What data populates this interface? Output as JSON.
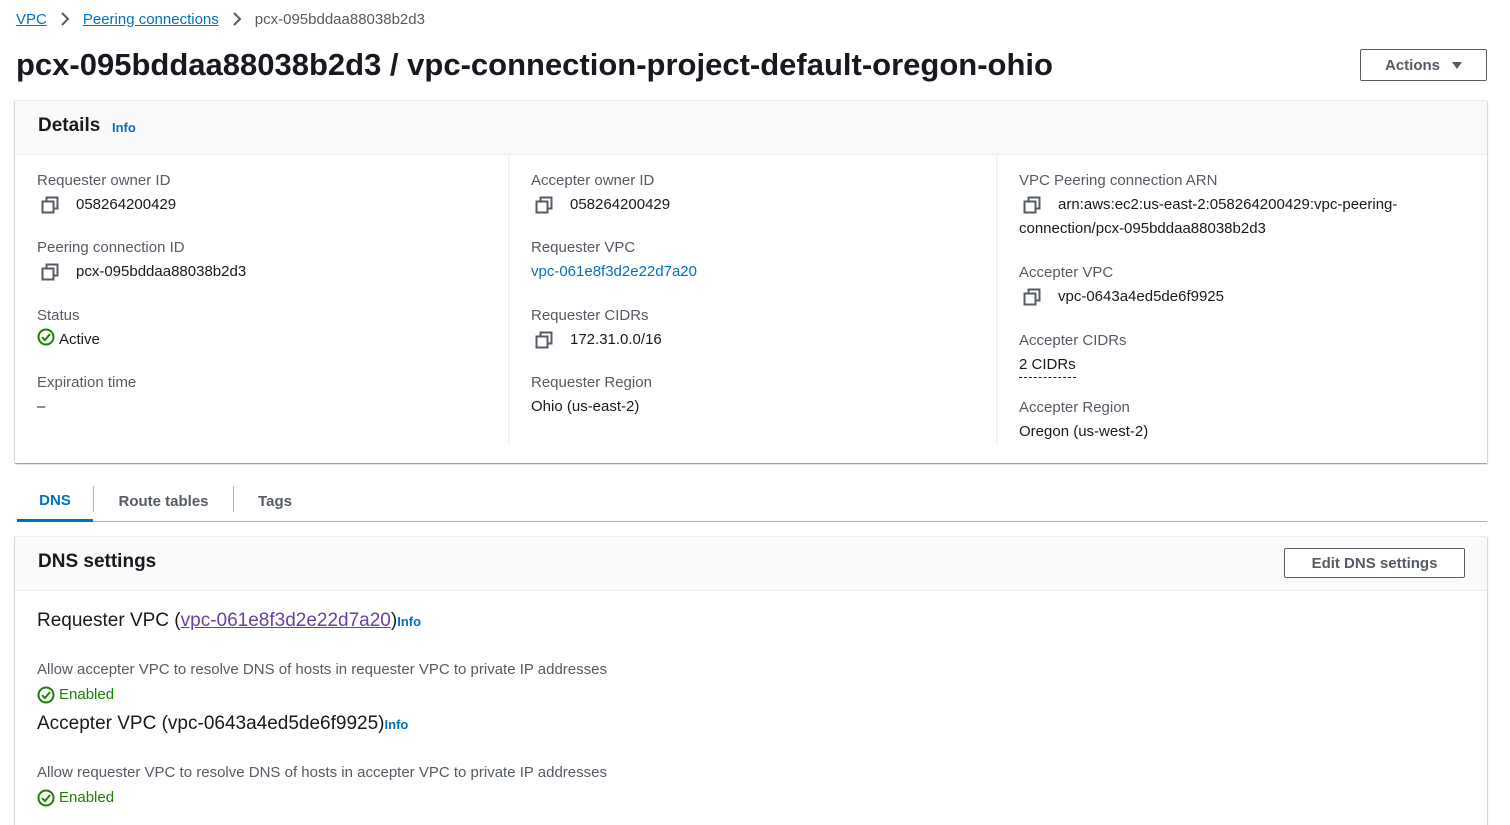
{
  "breadcrumb": {
    "items": [
      "VPC",
      "Peering connections"
    ],
    "current": "pcx-095bddaa88038b2d3"
  },
  "page": {
    "title": "pcx-095bddaa88038b2d3 / vpc-connection-project-default-oregon-ohio",
    "actions_label": "Actions"
  },
  "details": {
    "title": "Details",
    "info": "Info",
    "col1": {
      "requester_owner_id_label": "Requester owner ID",
      "requester_owner_id": "058264200429",
      "peering_id_label": "Peering connection ID",
      "peering_id": "pcx-095bddaa88038b2d3",
      "status_label": "Status",
      "status": "Active",
      "expiration_label": "Expiration time",
      "expiration": "–"
    },
    "col2": {
      "accepter_owner_id_label": "Accepter owner ID",
      "accepter_owner_id": "058264200429",
      "requester_vpc_label": "Requester VPC",
      "requester_vpc": "vpc-061e8f3d2e22d7a20",
      "requester_cidrs_label": "Requester CIDRs",
      "requester_cidrs": "172.31.0.0/16",
      "requester_region_label": "Requester Region",
      "requester_region": "Ohio (us-east-2)"
    },
    "col3": {
      "arn_label": "VPC Peering connection ARN",
      "arn_line1": "arn:aws:ec2:us-east-2:058264200429:vpc-peering-",
      "arn_line2": "connection/pcx-095bddaa88038b2d3",
      "accepter_vpc_label": "Accepter VPC",
      "accepter_vpc": "vpc-0643a4ed5de6f9925",
      "accepter_cidrs_label": "Accepter CIDRs",
      "accepter_cidrs": "2 CIDRs",
      "accepter_region_label": "Accepter Region",
      "accepter_region": "Oregon (us-west-2)"
    }
  },
  "tabs": [
    "DNS",
    "Route tables",
    "Tags"
  ],
  "dns": {
    "title": "DNS settings",
    "edit_label": "Edit DNS settings",
    "requester": {
      "prefix": "Requester VPC (",
      "vpc": "vpc-061e8f3d2e22d7a20",
      "suffix": ")",
      "info": "Info",
      "description": "Allow accepter VPC to resolve DNS of hosts in requester VPC to private IP addresses",
      "status": "Enabled"
    },
    "accepter": {
      "heading": "Accepter VPC (vpc-0643a4ed5de6f9925)",
      "info": "Info",
      "description": "Allow requester VPC to resolve DNS of hosts in accepter VPC to private IP addresses",
      "status": "Enabled"
    }
  },
  "colors": {
    "link": "#0073bb",
    "success": "#1d8102",
    "visited_link": "#6b3fa0"
  }
}
